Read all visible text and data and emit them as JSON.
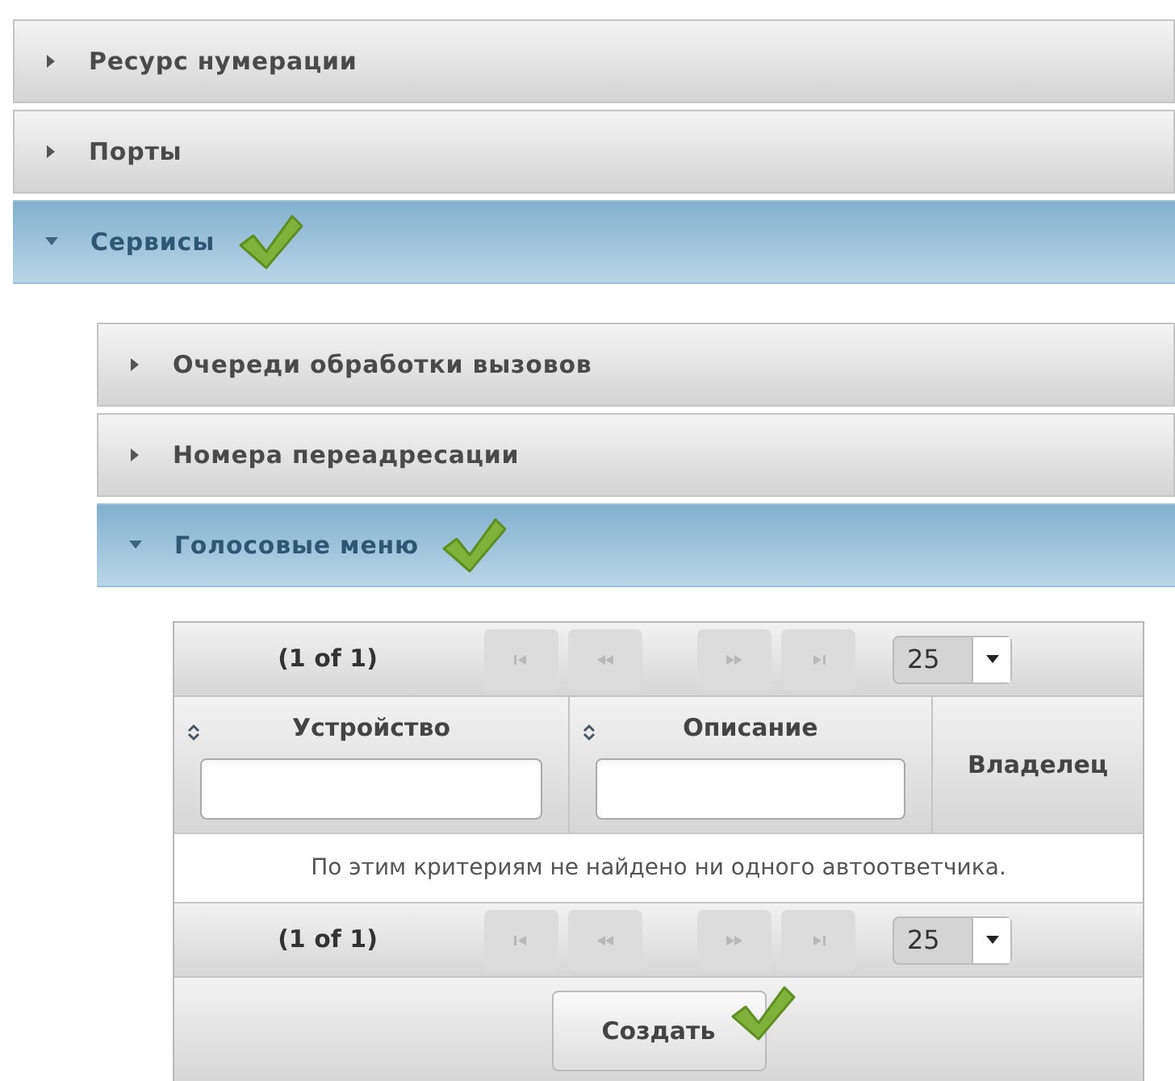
{
  "sections": [
    {
      "label": "Ресурс нумерации",
      "expanded": false,
      "marked": false
    },
    {
      "label": "Порты",
      "expanded": false,
      "marked": false
    },
    {
      "label": "Сервисы",
      "expanded": true,
      "marked": true
    }
  ],
  "subsections": [
    {
      "label": "Очереди обработки вызовов",
      "expanded": false,
      "marked": false
    },
    {
      "label": "Номера переадресации",
      "expanded": false,
      "marked": false
    },
    {
      "label": "Голосовые меню",
      "expanded": true,
      "marked": true
    }
  ],
  "table": {
    "top_pager": {
      "page_info": "(1 of 1)",
      "rows_per_page": "25"
    },
    "columns": [
      {
        "label": "Устройство",
        "sortable": true,
        "filter": true
      },
      {
        "label": "Описание",
        "sortable": true,
        "filter": true
      },
      {
        "label": "Владелец",
        "sortable": false,
        "filter": false
      }
    ],
    "empty_message": "По этим критериям не найдено ни одного автоответчика.",
    "bottom_pager": {
      "page_info": "(1 of 1)",
      "rows_per_page": "25"
    },
    "create_button": {
      "label": "Создать",
      "marked": true
    }
  }
}
